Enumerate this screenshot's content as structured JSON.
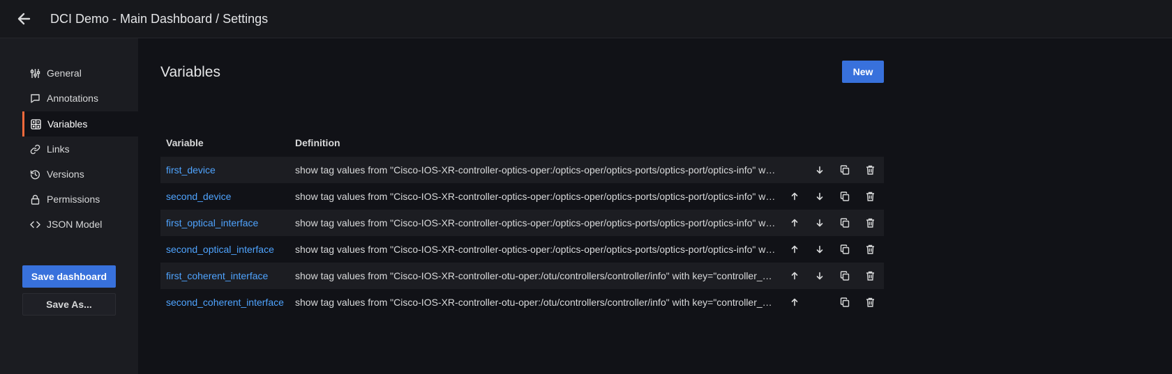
{
  "header": {
    "title": "DCI Demo - Main Dashboard / Settings"
  },
  "sidebar": {
    "items": [
      {
        "label": "General",
        "icon": "sliders-icon",
        "active": false
      },
      {
        "label": "Annotations",
        "icon": "comment-icon",
        "active": false
      },
      {
        "label": "Variables",
        "icon": "calculator-icon",
        "active": true
      },
      {
        "label": "Links",
        "icon": "link-icon",
        "active": false
      },
      {
        "label": "Versions",
        "icon": "history-icon",
        "active": false
      },
      {
        "label": "Permissions",
        "icon": "lock-icon",
        "active": false
      },
      {
        "label": "JSON Model",
        "icon": "code-icon",
        "active": false
      }
    ],
    "save_label": "Save dashboard",
    "save_as_label": "Save As..."
  },
  "main": {
    "title": "Variables",
    "new_label": "New",
    "columns": [
      "Variable",
      "Definition"
    ],
    "rows": [
      {
        "name": "first_device",
        "definition": "show tag values from \"Cisco-IOS-XR-controller-optics-oper:/optics-oper/optics-ports/optics-port/optics-info\" with key=\"source\""
      },
      {
        "name": "second_device",
        "definition": "show tag values from \"Cisco-IOS-XR-controller-optics-oper:/optics-oper/optics-ports/optics-port/optics-info\" with key=\"source\""
      },
      {
        "name": "first_optical_interface",
        "definition": "show tag values from \"Cisco-IOS-XR-controller-optics-oper:/optics-oper/optics-ports/optics-port/optics-info\" with key=\"name\""
      },
      {
        "name": "second_optical_interface",
        "definition": "show tag values from \"Cisco-IOS-XR-controller-optics-oper:/optics-oper/optics-ports/optics-port/optics-info\" with key=\"name\""
      },
      {
        "name": "first_coherent_interface",
        "definition": "show tag values from \"Cisco-IOS-XR-controller-otu-oper:/otu/controllers/controller/info\" with key=\"controller_name\""
      },
      {
        "name": "second_coherent_interface",
        "definition": "show tag values from \"Cisco-IOS-XR-controller-otu-oper:/otu/controllers/controller/info\" with key=\"controller_name\""
      }
    ]
  },
  "colors": {
    "accent": "#3871dc",
    "link": "#4fa4ff",
    "active_border": "#f5693b"
  }
}
